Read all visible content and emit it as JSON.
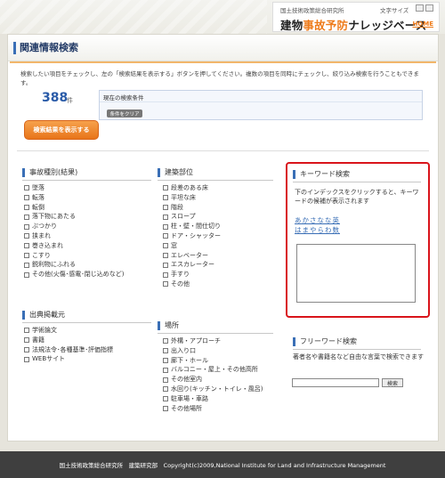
{
  "header": {
    "org_small": "国土技術政策総合研究所",
    "font_size_label": "文字サイズ",
    "logo_prefix": "建物",
    "logo_accent": "事故予防",
    "logo_suffix": "ナレッジベース",
    "home_link": "HOME"
  },
  "page": {
    "title": "関連情報検索",
    "intro": "検索したい項目をチェックし、左の「検索結果を表示する」ボタンを押してください。複数の項目を同時にチェックし、絞り込み検索を行うこともできます。",
    "count": "388",
    "count_unit": "件",
    "show_results_button": "検索結果を表示する",
    "current_conditions_label": "現在の検索条件",
    "clear_conditions_button": "条件をクリア"
  },
  "accident_type": {
    "heading": "事故種別(結果)",
    "items": [
      "墜落",
      "転落",
      "転倒",
      "落下物にあたる",
      "ぶつかり",
      "挟まれ",
      "巻き込まれ",
      "こすり",
      "鋭利物にふれる",
      "その他(火傷･感電･閉じ込めなど)"
    ]
  },
  "building_part": {
    "heading": "建築部位",
    "items": [
      "段差のある床",
      "平坦な床",
      "階段",
      "スロープ",
      "柱・壁・間仕切り",
      "ドア・シャッター",
      "窓",
      "エレベーター",
      "エスカレーター",
      "手すり",
      "その他"
    ]
  },
  "source": {
    "heading": "出典掲載元",
    "items": [
      "学術論文",
      "書籍",
      "法規法令･各種基準･評価指標",
      "WEBサイト"
    ]
  },
  "place": {
    "heading": "場所",
    "items": [
      "外構・アプローチ",
      "出入り口",
      "廊下・ホール",
      "バルコニー・屋上・その他高所",
      "その他室内",
      "水回り(キッチン・トイレ・風呂)",
      "駐車場・車路",
      "その他場所"
    ]
  },
  "keyword_search": {
    "heading": "キーワード検索",
    "description": "下のインデックスをクリックすると、キーワードの候補が表示されます",
    "index_row1": "あかさなな英",
    "index_row2": "はまやらわ数"
  },
  "free_word_search": {
    "heading": "フリーワード検索",
    "description": "著者名や書籍名など自由な言葉で検索できます",
    "search_button": "検索"
  },
  "footer": {
    "text": "国土技術政策総合研究所　建築研究部　Copyright(c)2009,National Institute for Land and Infrastructure Management"
  },
  "colors": {
    "accent_orange": "#ee7b1a",
    "link_blue": "#3a6fb6",
    "highlight_red": "#d9141b"
  }
}
